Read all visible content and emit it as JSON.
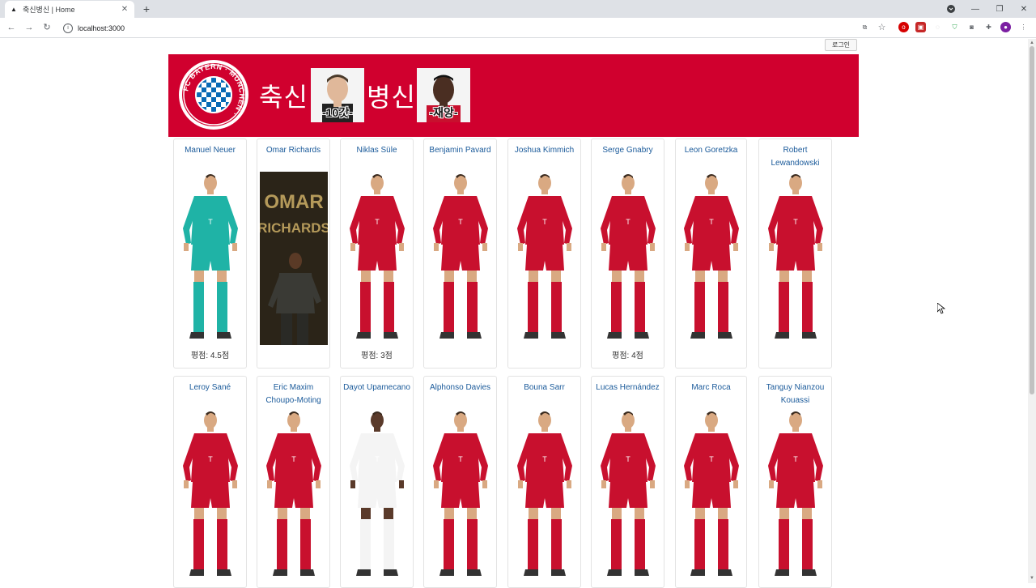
{
  "browser": {
    "tab_title": "축신병신 | Home",
    "url": "localhost:3000",
    "new_tab": "+",
    "tab_close": "✕"
  },
  "page": {
    "login_label": "로그인",
    "brand_part1": "축신",
    "brand_part2": "병신",
    "face1_caption": "-10갓-",
    "face2_caption": "-재앙-",
    "logo_text": "FC BAYERN MÜNCHEN"
  },
  "players_row1": [
    {
      "name": "Manuel Neuer",
      "rating": "평점: 4.5점",
      "kit": "keeper"
    },
    {
      "name": "Omar Richards",
      "rating": "",
      "kit": "poster"
    },
    {
      "name": "Niklas Süle",
      "rating": "평점: 3점",
      "kit": "home"
    },
    {
      "name": "Benjamin Pavard",
      "rating": "",
      "kit": "home"
    },
    {
      "name": "Joshua Kimmich",
      "rating": "",
      "kit": "home"
    },
    {
      "name": "Serge Gnabry",
      "rating": "평점: 4점",
      "kit": "home"
    },
    {
      "name": "Leon Goretzka",
      "rating": "",
      "kit": "home"
    },
    {
      "name": "Robert Lewandowski",
      "rating": "",
      "kit": "home"
    }
  ],
  "players_row2": [
    {
      "name": "Leroy Sané",
      "kit": "home"
    },
    {
      "name": "Eric Maxim Choupo-Moting",
      "kit": "home"
    },
    {
      "name": "Dayot Upamecano",
      "kit": "white"
    },
    {
      "name": "Alphonso Davies",
      "kit": "home"
    },
    {
      "name": "Bouna Sarr",
      "kit": "home"
    },
    {
      "name": "Lucas Hernández",
      "kit": "home"
    },
    {
      "name": "Marc Roca",
      "kit": "home"
    },
    {
      "name": "Tanguy Nianzou Kouassi",
      "kit": "home"
    }
  ],
  "poster_text": [
    "OMAR",
    "RICHARDS"
  ],
  "colors": {
    "banner": "#d0002e",
    "home_kit": "#c8102e",
    "keeper_kit": "#1fb3a6",
    "player_name": "#1a5a9a"
  }
}
